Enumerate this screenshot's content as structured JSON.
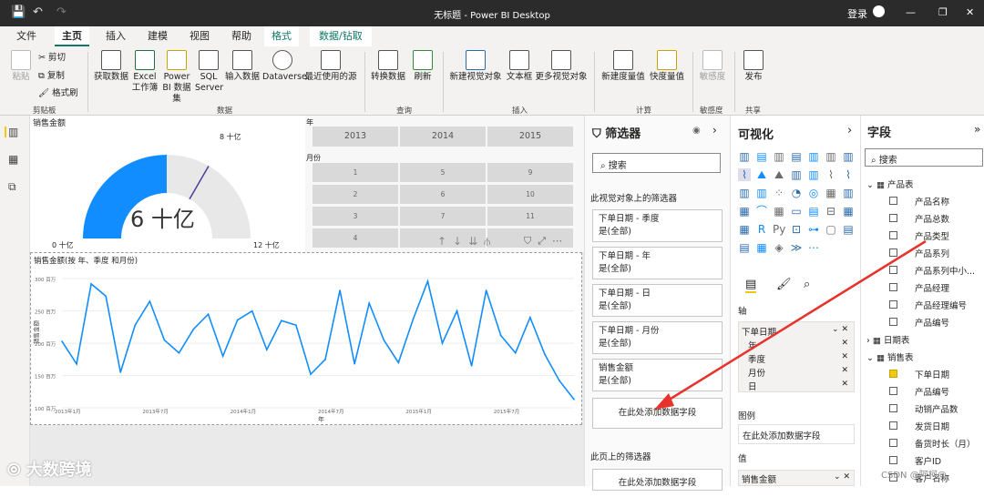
{
  "window": {
    "title": "无标题 - Power BI Desktop",
    "signin": "登录"
  },
  "tabs": [
    "文件",
    "主页",
    "插入",
    "建模",
    "视图",
    "帮助",
    "格式",
    "数据/钻取"
  ],
  "ribbon": {
    "paste": "粘贴",
    "cut": "剪切",
    "copy": "复制",
    "format_painter": "格式刷",
    "get_data": "获取数据",
    "excel": "Excel 工作簿",
    "pbi_dataset": "Power BI 数据集",
    "sql": "SQL Server",
    "enter_data": "输入数据",
    "dataverse": "Dataverse",
    "recent": "最近使用的源",
    "transform": "转换数据",
    "refresh": "刷新",
    "new_visual": "新建视觉对象",
    "textbox": "文本框",
    "more_visuals": "更多视觉对象",
    "new_measure": "新建度量值",
    "quick_measure": "快度量值",
    "sensitivity": "敏感度",
    "publish": "发布",
    "groups": {
      "clipboard": "剪贴板",
      "data": "数据",
      "query": "查询",
      "insert": "插入",
      "calc": "计算",
      "sens": "敏感度",
      "share": "共享"
    }
  },
  "gauge": {
    "title": "销售金额",
    "value": "6 十亿",
    "target": "8 十亿",
    "min": "0 十亿",
    "max": "12 十亿",
    "fraction": 0.5
  },
  "matrix": {
    "corner": "年",
    "row_header": "月份",
    "years": [
      "2013",
      "2014",
      "2015"
    ],
    "rows": [
      [
        "1",
        "5",
        "9"
      ],
      [
        "2",
        "6",
        "10"
      ],
      [
        "3",
        "7",
        "11"
      ],
      [
        "4",
        "",
        ""
      ]
    ]
  },
  "line": {
    "title": "销售金额(按 年、季度 和月份)",
    "ylabel": "销售金额",
    "xlabel": "年",
    "yticks": [
      "300 百万",
      "250 百万",
      "200 百万",
      "150 百万",
      "100 百万"
    ],
    "xticks": [
      "2013年1月",
      "2013年7月",
      "2014年1月",
      "2014年7月",
      "2015年1月",
      "2015年7月"
    ]
  },
  "chart_data": {
    "type": "line",
    "title": "销售金额(按 年、季度 和月份)",
    "xlabel": "年",
    "ylabel": "销售金额",
    "ylim": [
      100,
      320
    ],
    "x": [
      "2013年1月",
      "2013年2月",
      "2013年3月",
      "2013年4月",
      "2013年5月",
      "2013年6月",
      "2013年7月",
      "2013年8月",
      "2013年9月",
      "2013年10月",
      "2013年11月",
      "2013年12月",
      "2014年1月",
      "2014年2月",
      "2014年3月",
      "2014年4月",
      "2014年5月",
      "2014年6月",
      "2014年7月",
      "2014年8月",
      "2014年9月",
      "2014年10月",
      "2014年11月",
      "2014年12月",
      "2015年1月",
      "2015年2月",
      "2015年3月",
      "2015年4月",
      "2015年5月",
      "2015年6月",
      "2015年7月",
      "2015年8月",
      "2015年9月",
      "2015年10月",
      "2015年11月",
      "2015年12月"
    ],
    "series": [
      {
        "values": [
          203,
          168,
          292,
          273,
          155,
          228,
          265,
          205,
          185,
          222,
          245,
          180,
          236,
          250,
          190,
          235,
          228,
          152,
          175,
          282,
          168,
          262,
          205,
          170,
          237,
          296,
          200,
          250,
          165,
          282,
          212,
          185,
          240,
          183,
          142,
          113
        ]
      }
    ]
  },
  "filters": {
    "title": "筛选器",
    "search": "搜索",
    "section_visual": "此视觉对象上的筛选器",
    "cards": [
      {
        "name": "下单日期 - 季度",
        "val": "是(全部)"
      },
      {
        "name": "下单日期 - 年",
        "val": "是(全部)"
      },
      {
        "name": "下单日期 - 日",
        "val": "是(全部)"
      },
      {
        "name": "下单日期 - 月份",
        "val": "是(全部)"
      },
      {
        "name": "销售金额",
        "val": "是(全部)"
      }
    ],
    "add": "在此处添加数据字段",
    "section_page": "此页上的筛选器",
    "add_page": "在此处添加数据字段"
  },
  "viz": {
    "title": "可视化",
    "axis": "轴",
    "axis_items": [
      "下单日期",
      "年",
      "季度",
      "月份",
      "日"
    ],
    "legend": "图例",
    "legend_add": "在此处添加数据字段",
    "values": "值",
    "value_item": "销售金额"
  },
  "fields": {
    "title": "字段",
    "search": "搜索",
    "tables": [
      {
        "name": "产品表",
        "items": [
          "产品名称",
          "产品总数",
          "产品类型",
          "产品系列",
          "产品系列中小...",
          "产品经理",
          "产品经理编号",
          "产品编号"
        ]
      },
      {
        "name": "日期表",
        "items": []
      },
      {
        "name": "销售表",
        "items": [
          "下单日期",
          "产品编号",
          "动销产品数",
          "发货日期",
          "备货时长（月）",
          "客户ID",
          "客户名称"
        ]
      }
    ]
  },
  "watermark": {
    "left": "大数跨境",
    "right": "CSDN @阿柯@"
  }
}
